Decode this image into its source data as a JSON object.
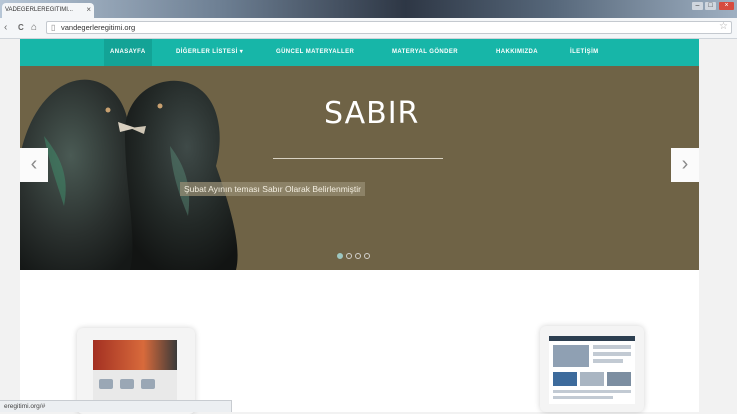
{
  "browser": {
    "tab_title": "VADEGERLEREGITIMI...",
    "tab_close": "×",
    "url": "vandegerleregitimi.org",
    "nav_back": "‹",
    "nav_reload": "C",
    "nav_home": "⌂",
    "window_min": "–",
    "window_max": "□",
    "window_close": "×",
    "status_text": "eregitimi.org/#"
  },
  "site": {
    "nav": [
      {
        "label": "ANASAYFA",
        "active": true
      },
      {
        "label": "DİĞERLER LİSTESİ ▾"
      },
      {
        "label": "GÜNCEL MATERYALLER"
      },
      {
        "label": "MATERYAL GÖNDER"
      },
      {
        "label": "HAKKIMIZDA"
      },
      {
        "label": "İLETİŞİM"
      }
    ],
    "slider": {
      "title": "SABIR",
      "caption": "Şubat Ayının teması Sabır Olarak Belirlenmiştir",
      "prev": "‹",
      "next": "›",
      "slide_count": 4,
      "active_index": 0
    }
  },
  "colors": {
    "accent": "#17b6a8",
    "slider_bg": "#6f6346"
  }
}
